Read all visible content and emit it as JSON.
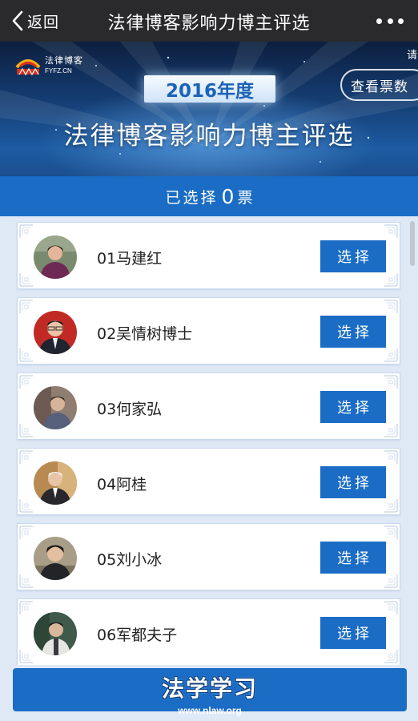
{
  "nav": {
    "back_label": "返回",
    "title": "法律博客影响力博主评选"
  },
  "banner": {
    "logo_cn": "法律博客",
    "logo_en": "FYFZ.CN",
    "year": "2016年度",
    "title": "法律博客影响力博主评选",
    "view_votes_label": "查看票数",
    "corner_char": "请"
  },
  "selection": {
    "prefix": "已选择",
    "count": "0",
    "unit": "票"
  },
  "candidates": [
    {
      "name": "01马建红",
      "button": "选择"
    },
    {
      "name": "02吴情树博士",
      "button": "选择"
    },
    {
      "name": "03何家弘",
      "button": "选择"
    },
    {
      "name": "04阿桂",
      "button": "选择"
    },
    {
      "name": "05刘小冰",
      "button": "选择"
    },
    {
      "name": "06军都夫子",
      "button": "选择"
    }
  ],
  "watermark": {
    "title": "法学学习",
    "url": "www.nlaw.org"
  },
  "colors": {
    "accent": "#1a6cc4",
    "nav_bg": "#2a2a2c",
    "page_bg": "#dfe9f6"
  }
}
